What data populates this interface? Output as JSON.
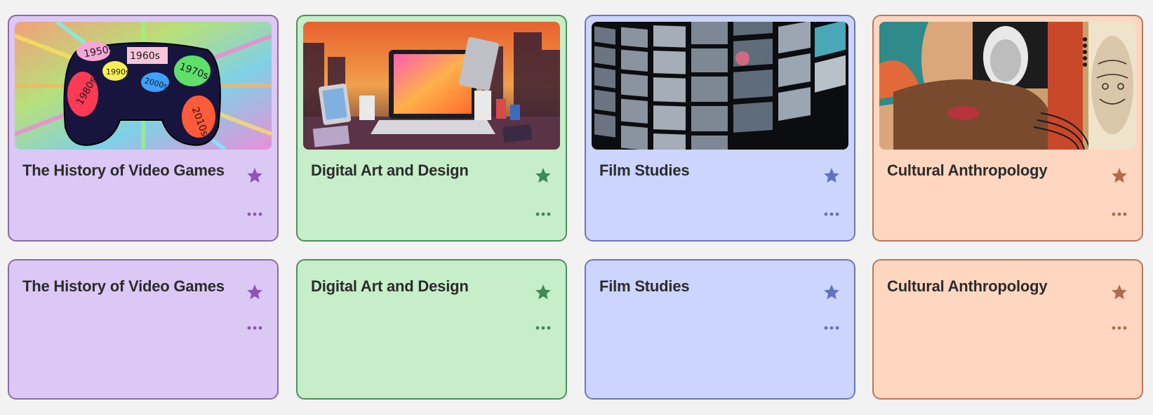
{
  "courses": [
    {
      "title": "The History of Video Games",
      "theme": "#dcc8f4",
      "accent": "#8f55b6",
      "icon": "star-icon"
    },
    {
      "title": "Digital Art and Design",
      "theme": "#c6eec8",
      "accent": "#3f8a55",
      "icon": "star-icon"
    },
    {
      "title": "Film Studies",
      "theme": "#cbd5fd",
      "accent": "#6470c2",
      "icon": "star-icon"
    },
    {
      "title": "Cultural Anthropology",
      "theme": "#ffd6bf",
      "accent": "#b06a4e",
      "icon": "star-icon"
    }
  ],
  "thumbnails": {
    "video_games": {
      "labels": [
        "1950s",
        "1960s",
        "1970s",
        "1980s",
        "1990s",
        "2000s",
        "2010s"
      ]
    }
  },
  "menu_icon": "more-horizontal-icon"
}
